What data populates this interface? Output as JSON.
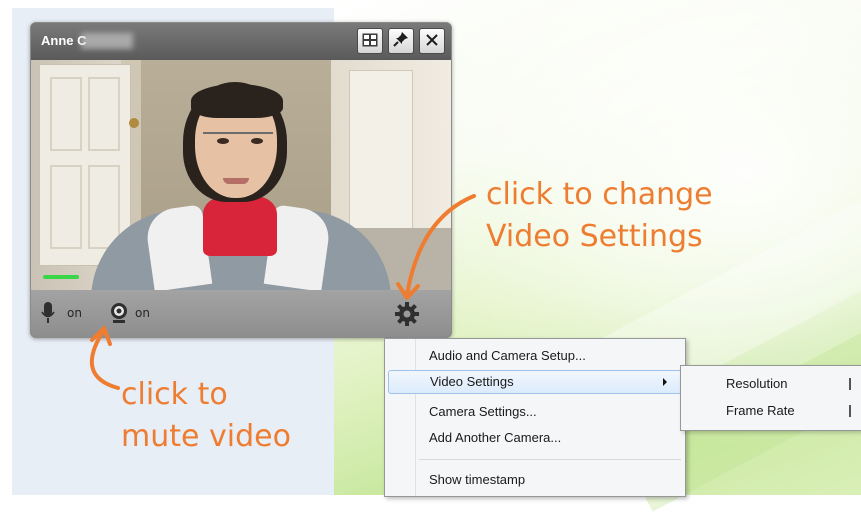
{
  "video_window": {
    "user_name": "Anne C",
    "title_buttons": [
      {
        "icon": "layout-grid-icon"
      },
      {
        "icon": "pin-icon"
      },
      {
        "icon": "close-icon"
      }
    ],
    "mic_status": "on",
    "camera_status": "on",
    "settings_icon": "gear-icon"
  },
  "annotations": {
    "settings_hint": "click to change\nVideo Settings",
    "mute_hint": "click to\nmute video",
    "color": "#ee7d31"
  },
  "context_menu": {
    "items": [
      {
        "label": "Audio and Camera Setup..."
      },
      {
        "label": "Video Settings",
        "highlighted": true,
        "has_submenu": true
      },
      {
        "label": "Camera Settings..."
      },
      {
        "label": "Add Another Camera..."
      },
      {
        "label": "Show timestamp"
      }
    ]
  },
  "sub_menu": {
    "items": [
      {
        "label": "Resolution"
      },
      {
        "label": "Frame Rate"
      }
    ]
  }
}
